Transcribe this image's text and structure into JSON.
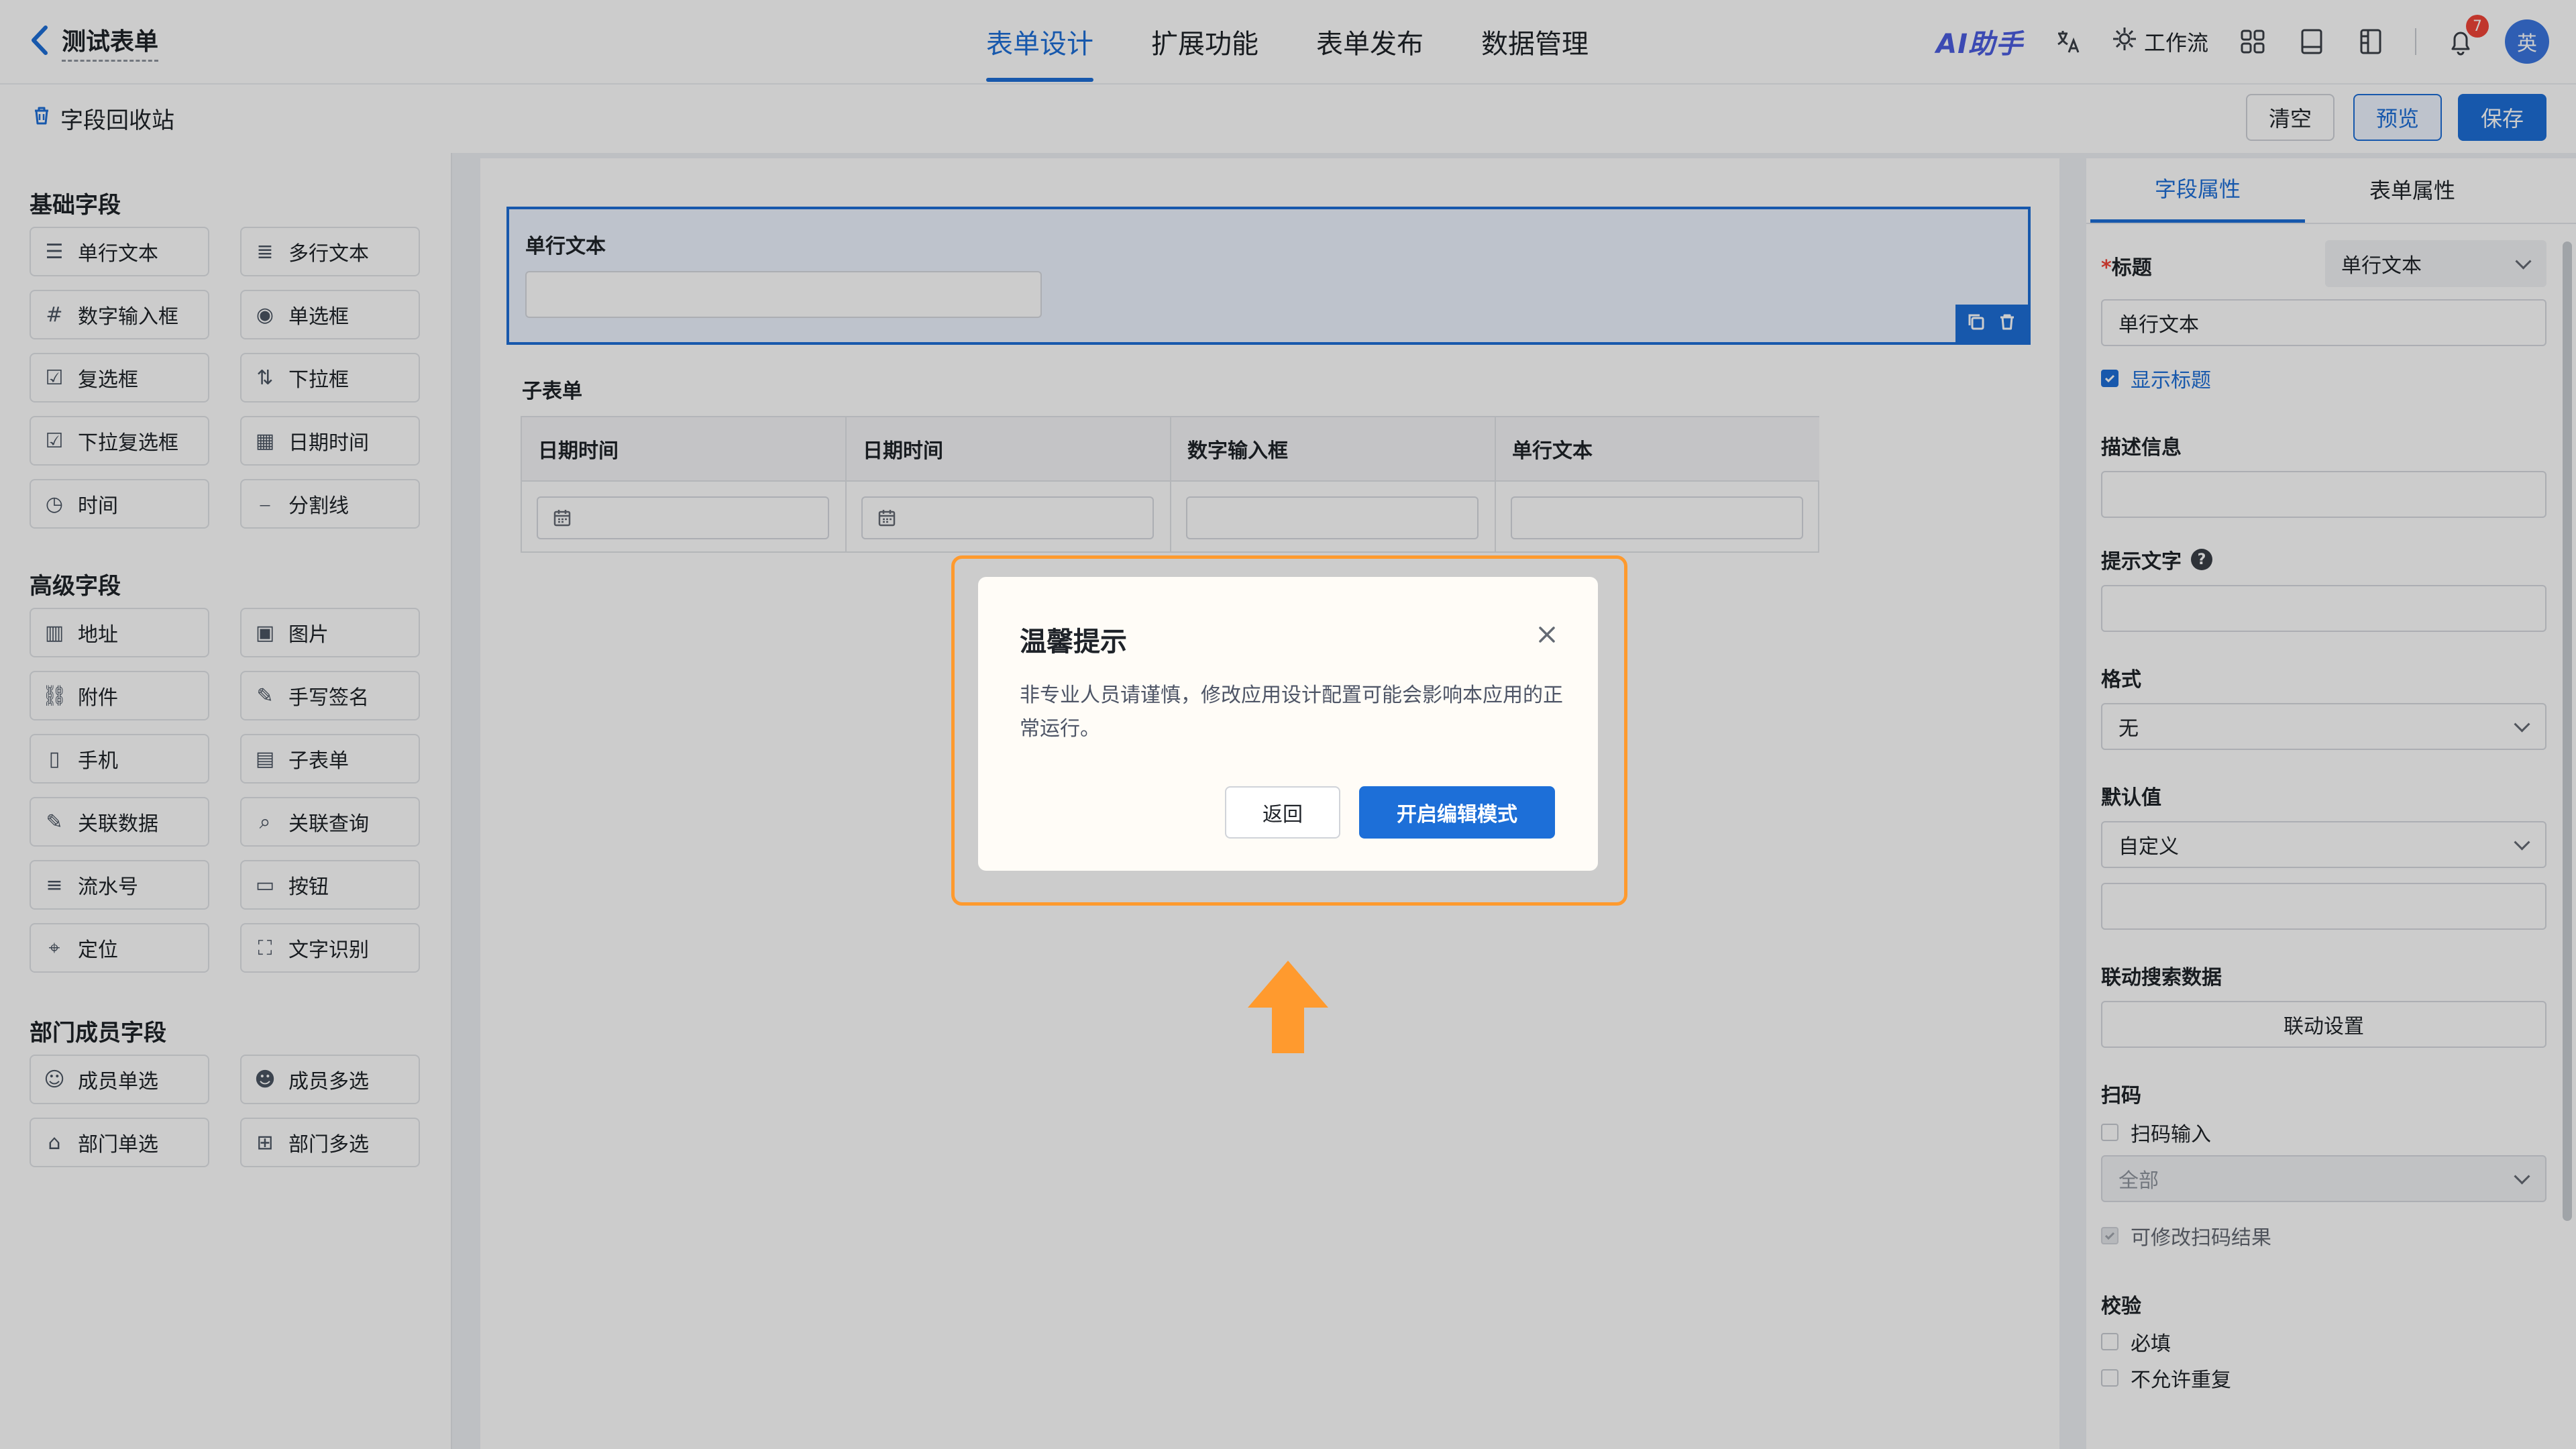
{
  "header": {
    "form_title": "测试表单",
    "nav": [
      "表单设计",
      "扩展功能",
      "表单发布",
      "数据管理"
    ],
    "active_nav": "表单设计",
    "ai_label": "AI助手",
    "workflow_label": "工作流",
    "notification_count": "7",
    "avatar_text": "英"
  },
  "subbar": {
    "recycle_label": "字段回收站",
    "clear_label": "清空",
    "preview_label": "预览",
    "save_label": "保存"
  },
  "left": {
    "groups": [
      {
        "title": "基础字段",
        "items": [
          {
            "label": "单行文本",
            "icon": "text-lines-icon"
          },
          {
            "label": "多行文本",
            "icon": "multiline-icon"
          },
          {
            "label": "数字输入框",
            "icon": "number-icon"
          },
          {
            "label": "单选框",
            "icon": "radio-icon"
          },
          {
            "label": "复选框",
            "icon": "checkbox-icon"
          },
          {
            "label": "下拉框",
            "icon": "sort-icon"
          },
          {
            "label": "下拉复选框",
            "icon": "multi-select-icon"
          },
          {
            "label": "日期时间",
            "icon": "calendar-icon"
          },
          {
            "label": "时间",
            "icon": "clock-icon"
          },
          {
            "label": "分割线",
            "icon": "divider-icon"
          }
        ]
      },
      {
        "title": "高级字段",
        "items": [
          {
            "label": "地址",
            "icon": "building-icon"
          },
          {
            "label": "图片",
            "icon": "image-icon"
          },
          {
            "label": "附件",
            "icon": "link-icon"
          },
          {
            "label": "手写签名",
            "icon": "pen-icon"
          },
          {
            "label": "手机",
            "icon": "phone-icon"
          },
          {
            "label": "子表单",
            "icon": "subform-icon"
          },
          {
            "label": "关联数据",
            "icon": "edit-link-icon"
          },
          {
            "label": "关联查询",
            "icon": "search-doc-icon"
          },
          {
            "label": "流水号",
            "icon": "serial-icon"
          },
          {
            "label": "按钮",
            "icon": "button-icon"
          },
          {
            "label": "定位",
            "icon": "location-icon"
          },
          {
            "label": "文字识别",
            "icon": "ocr-icon"
          }
        ]
      },
      {
        "title": "部门成员字段",
        "items": [
          {
            "label": "成员单选",
            "icon": "user-icon"
          },
          {
            "label": "成员多选",
            "icon": "users-icon"
          },
          {
            "label": "部门单选",
            "icon": "bank-icon"
          },
          {
            "label": "部门多选",
            "icon": "org-icon"
          }
        ]
      }
    ]
  },
  "canvas": {
    "field_label": "单行文本",
    "subform_label": "子表单",
    "subform_columns": [
      "日期时间",
      "日期时间",
      "数字输入框",
      "单行文本"
    ]
  },
  "right": {
    "tabs": [
      "字段属性",
      "表单属性"
    ],
    "title_label": "标题",
    "title_type": "单行文本",
    "title_value": "单行文本",
    "show_title": "显示标题",
    "desc_label": "描述信息",
    "hint_label": "提示文字",
    "format_label": "格式",
    "format_value": "无",
    "default_label": "默认值",
    "default_value": "自定义",
    "link_label": "联动搜索数据",
    "link_button": "联动设置",
    "scan_label": "扫码",
    "scan_input": "扫码输入",
    "scan_scope": "全部",
    "scan_modify": "可修改扫码结果",
    "verify_label": "校验",
    "required": "必填",
    "no_dup": "不允许重复"
  },
  "modal": {
    "title": "温馨提示",
    "message": "非专业人员请谨慎，修改应用设计配置可能会影响本应用的正常运行。",
    "back": "返回",
    "confirm": "开启编辑模式"
  },
  "colors": {
    "accent": "#1d6fd8",
    "highlight": "#ff9a2e"
  }
}
